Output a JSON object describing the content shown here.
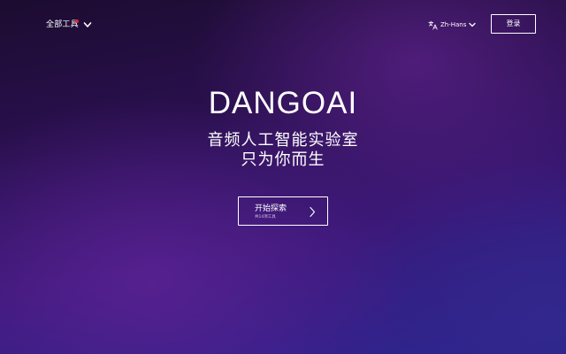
{
  "header": {
    "menu_label": "全部工具",
    "menu_icon": "chevron-down-icon",
    "notification_dot_color": "#e0243a",
    "language_icon": "translate-icon",
    "language_label": "Zh-Hans",
    "language_chevron_icon": "chevron-down-icon",
    "login_label": "登录"
  },
  "hero": {
    "title": "DANGOAI",
    "subtitle_line1": "音频人工智能实验室",
    "subtitle_line2": "只为你而生",
    "cta_label": "开始探索",
    "cta_sublabel": "共14项工具",
    "cta_icon": "chevron-right-icon"
  },
  "colors": {
    "text": "#ffffff",
    "background_top": "#1c0c30",
    "background_bottom": "#2a2490",
    "accent_dot": "#e0243a"
  }
}
